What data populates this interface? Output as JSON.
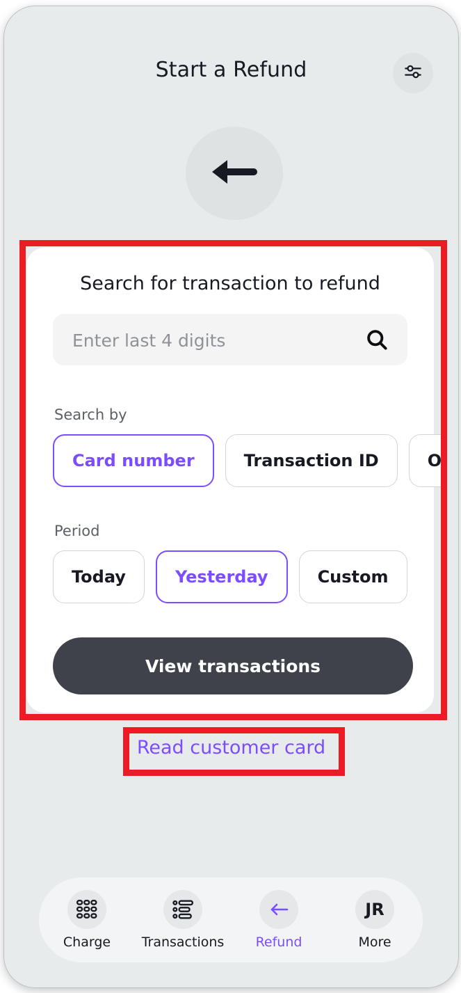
{
  "header": {
    "title": "Start a Refund",
    "filter_icon": "sliders-icon"
  },
  "back_button": {
    "icon": "arrow-left-icon"
  },
  "card": {
    "title": "Search for transaction to refund",
    "search": {
      "placeholder": "Enter last 4 digits",
      "value": "",
      "icon": "search-icon"
    },
    "search_by": {
      "label": "Search by",
      "options": [
        {
          "label": "Card number",
          "selected": true
        },
        {
          "label": "Transaction ID",
          "selected": false
        },
        {
          "label": "Order",
          "selected": false
        }
      ]
    },
    "period": {
      "label": "Period",
      "options": [
        {
          "label": "Today",
          "selected": false
        },
        {
          "label": "Yesterday",
          "selected": true
        },
        {
          "label": "Custom",
          "selected": false
        }
      ]
    },
    "submit_label": "View transactions"
  },
  "read_card_link": "Read customer card",
  "bottom_nav": [
    {
      "label": "Charge",
      "icon": "keypad-grid-icon",
      "active": false
    },
    {
      "label": "Transactions",
      "icon": "list-lines-icon",
      "active": false
    },
    {
      "label": "Refund",
      "icon": "arrow-left-icon",
      "active": true
    },
    {
      "label": "More",
      "icon": "avatar-initials",
      "avatar": "JR",
      "active": false
    }
  ],
  "colors": {
    "accent_purple": "#7c4dff",
    "dark_button": "#3f414b",
    "screen_background": "#e8ebec",
    "card_background": "#ffffff",
    "annotation_red": "#ed1c24"
  }
}
